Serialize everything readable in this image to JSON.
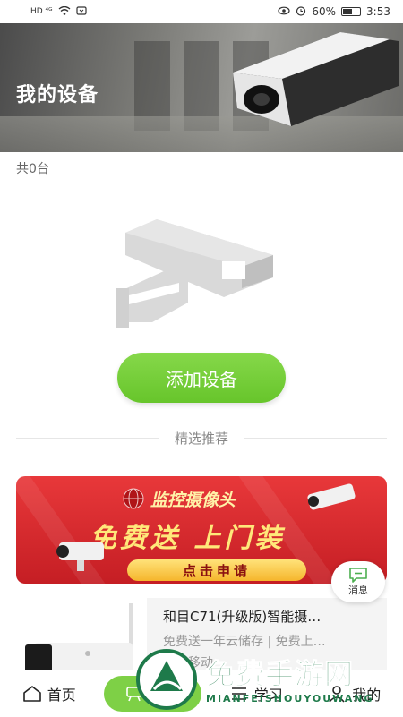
{
  "status_bar": {
    "left_text": "HD ⁴ᴳ",
    "battery": "60%",
    "time": "3:53",
    "battery_level": 0.6
  },
  "header": {
    "title": "我的设备"
  },
  "device_count": "共0台",
  "add_device_label": "添加设备",
  "section_title": "精选推荐",
  "promo": {
    "line1": "监控摄像头",
    "line2": "免费送 上门装",
    "cta": "点击申请"
  },
  "message_button": {
    "label": "消息",
    "icon": "chat-bubble-icon"
  },
  "product": {
    "title": "和目C71(升级版)智能摄…",
    "subtitle": "免费送一年云储存 | 免费上…",
    "vendor": "中国移动"
  },
  "tabbar": {
    "items": [
      {
        "label": "首页",
        "icon": "home-icon"
      },
      {
        "label": "设备",
        "icon": "camera-tab-icon",
        "active": true
      },
      {
        "label": "学习",
        "icon": "learn-icon"
      },
      {
        "label": "我的",
        "icon": "profile-icon"
      }
    ]
  },
  "watermark": {
    "title": "免费手游网",
    "subtitle": "MIANFEISHOUYOUWANG"
  },
  "colors": {
    "accent": "#6cc72f",
    "promo_red": "#d42a2c",
    "text_gray": "#999999"
  }
}
